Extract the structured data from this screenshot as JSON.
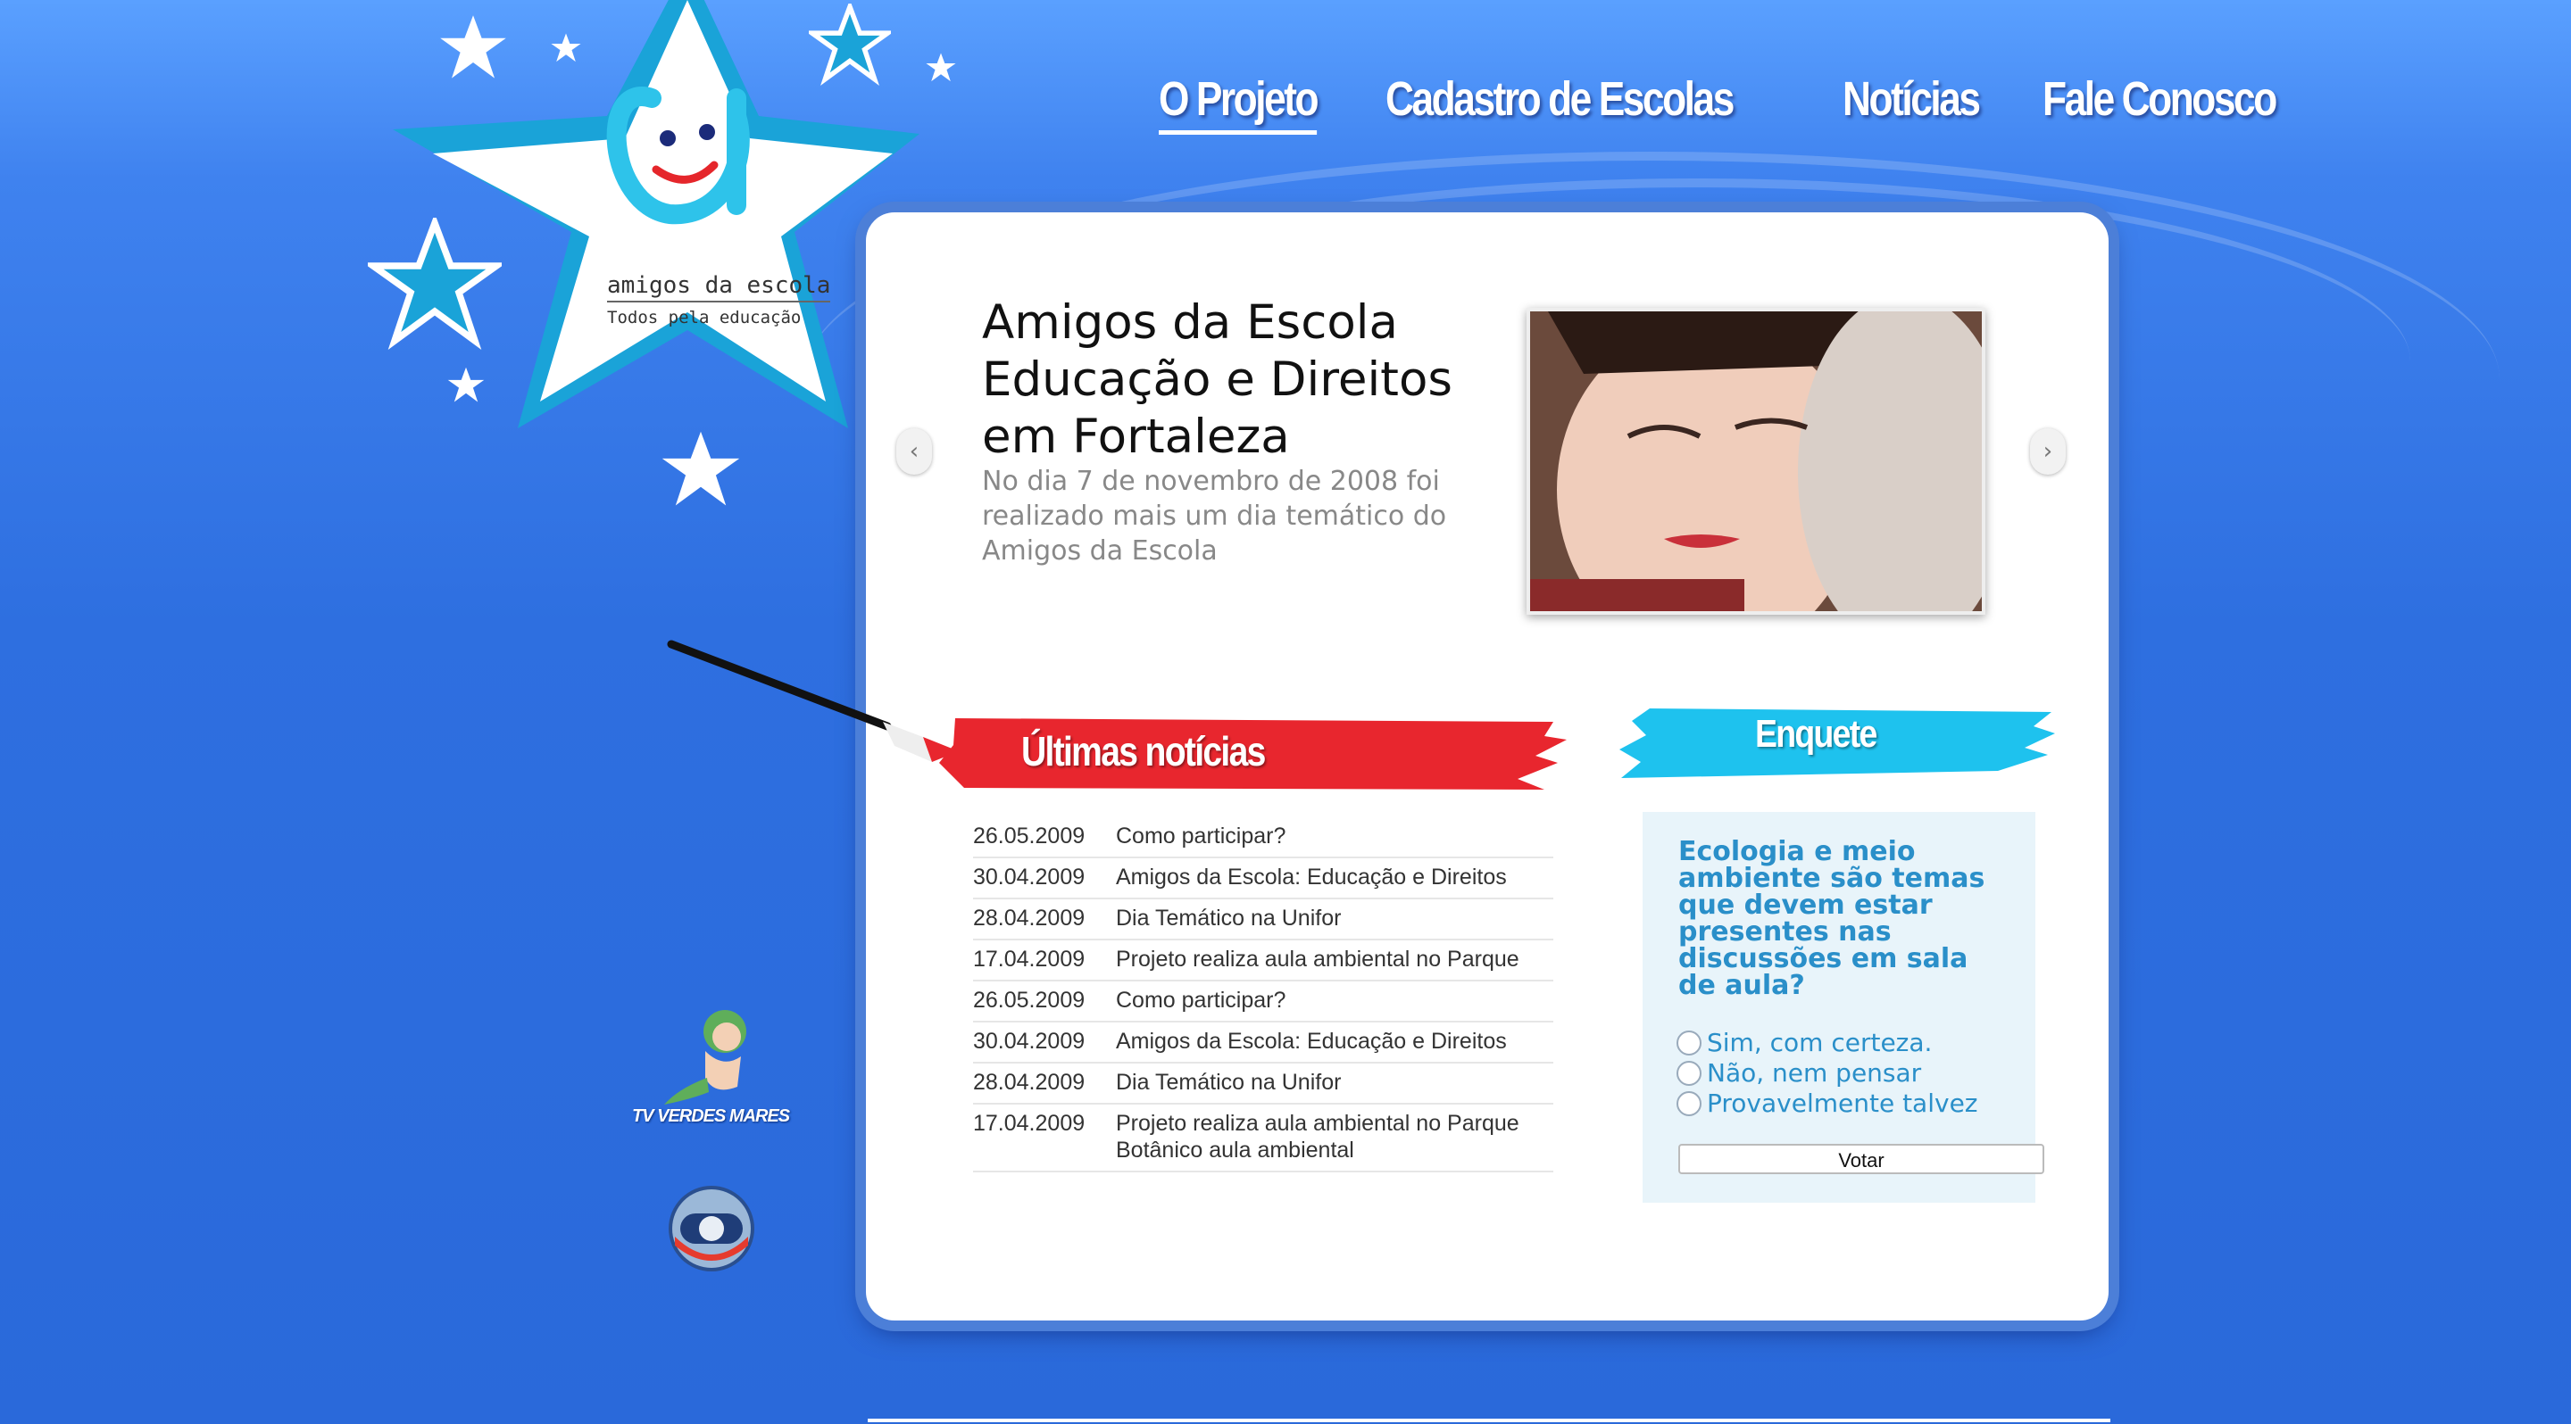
{
  "brand": {
    "name": "amigos da escola",
    "tagline": "Todos pela educação"
  },
  "nav": [
    {
      "label": "O Projeto",
      "active": true
    },
    {
      "label": "Cadastro de Escolas",
      "active": false
    },
    {
      "label": "Notícias",
      "active": false
    },
    {
      "label": "Fale Conosco",
      "active": false
    }
  ],
  "feature": {
    "headline": "Amigos da Escola Educação e Direitos em Fortaleza",
    "summary": "No dia 7 de novembro de 2008 foi realizado mais um dia temático do Amigos da Escola",
    "prev_icon": "‹",
    "next_icon": "›"
  },
  "news_section": {
    "title": "Últimas notícias",
    "items": [
      {
        "date": "26.05.2009",
        "title": "Como participar?"
      },
      {
        "date": "30.04.2009",
        "title": "Amigos da Escola: Educação e Direitos"
      },
      {
        "date": "28.04.2009",
        "title": "Dia Temático na Unifor"
      },
      {
        "date": "17.04.2009",
        "title": "Projeto realiza aula ambiental no Parque"
      },
      {
        "date": "26.05.2009",
        "title": "Como participar?"
      },
      {
        "date": "30.04.2009",
        "title": "Amigos da Escola: Educação e Direitos"
      },
      {
        "date": "28.04.2009",
        "title": "Dia Temático na Unifor"
      },
      {
        "date": "17.04.2009",
        "title": "Projeto realiza aula ambiental no Parque Botânico aula ambiental"
      }
    ]
  },
  "poll": {
    "title": "Enquete",
    "question": "Ecologia e meio ambiente são temas que devem estar presentes nas discussões em sala de aula?",
    "options": [
      "Sim, com certeza.",
      "Não, nem pensar",
      "Provavelmente talvez"
    ],
    "vote_label": "Votar"
  },
  "sponsors": {
    "tv_label": "TV VERDES MARES"
  },
  "colors": {
    "background": "#2e6fe0",
    "banner_red": "#e8262e",
    "banner_cyan": "#1ec2ee",
    "poll_text": "#2a8fc9"
  }
}
